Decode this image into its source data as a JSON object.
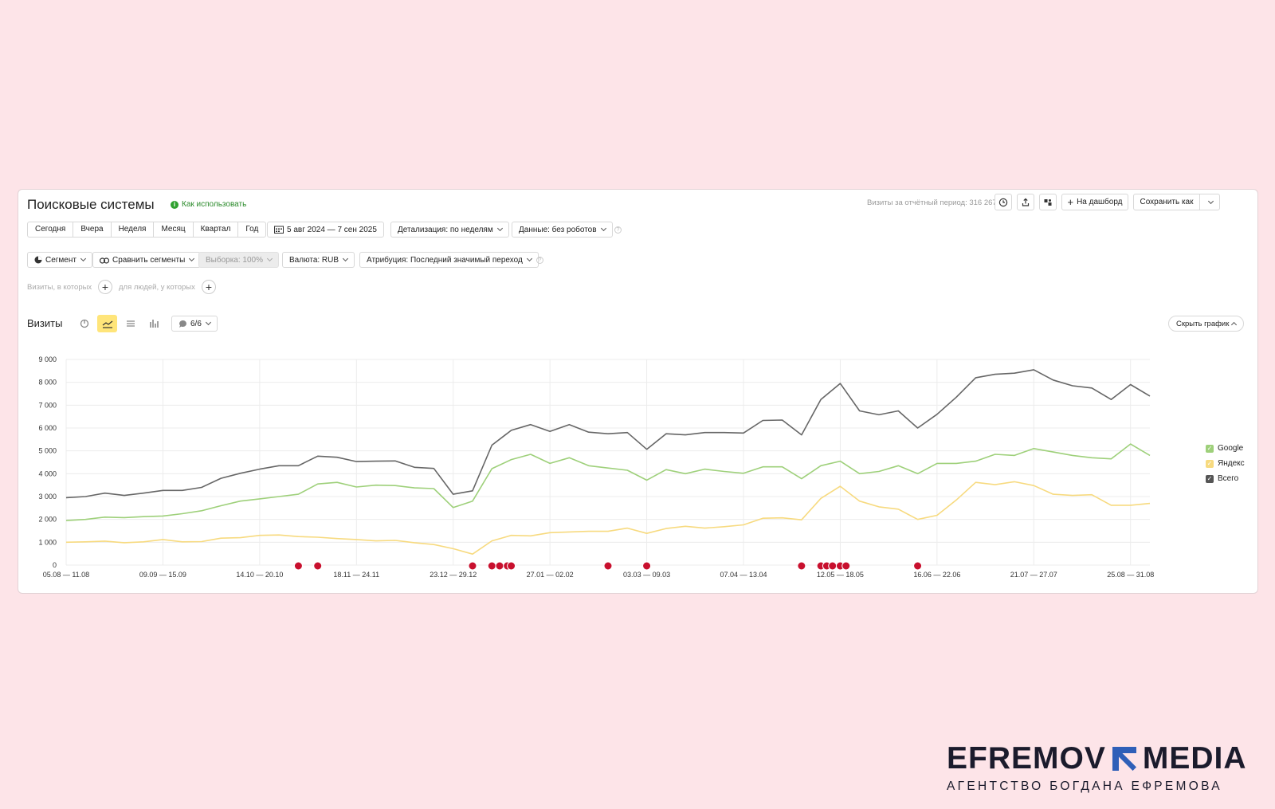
{
  "header": {
    "title": "Поисковые системы",
    "how_to_use": "Как использовать",
    "visits_total": "Визиты за отчётный период: 316 267",
    "to_dashboard": "На дашборд",
    "save_as": "Сохранить как"
  },
  "period_buttons": [
    "Сегодня",
    "Вчера",
    "Неделя",
    "Месяц",
    "Квартал",
    "Год"
  ],
  "date_range": "5 авг 2024 — 7 сен 2025",
  "detail": "Детализация: по неделям",
  "data_filter": "Данные: без роботов",
  "segment": "Сегмент",
  "compare": "Сравнить сегменты",
  "sample": "Выборка: 100%",
  "currency": "Валюта: RUB",
  "attribution": "Атрибуция: Последний значимый переход",
  "filters": {
    "visits_where": "Визиты, в которых",
    "people_where": "для людей, у которых"
  },
  "chart_header": {
    "label": "Визиты",
    "annotations": "6/6",
    "hide": "Скрыть график"
  },
  "colors": {
    "google": "#9ed07a",
    "yandex": "#f7da7f",
    "total": "#666666",
    "marker": "#c8102e",
    "accent": "#ffe57a"
  },
  "chart_data": {
    "type": "line",
    "x_ticks": [
      "05.08 — 11.08",
      "09.09 — 15.09",
      "14.10 — 20.10",
      "18.11 — 24.11",
      "23.12 — 29.12",
      "27.01 — 02.02",
      "03.03 — 09.03",
      "07.04 — 13.04",
      "12.05 — 18.05",
      "16.06 — 22.06",
      "21.07 — 27.07",
      "25.08 — 31.08"
    ],
    "y_ticks": [
      "0",
      "1 000",
      "2 000",
      "3 000",
      "4 000",
      "5 000",
      "6 000",
      "7 000",
      "8 000",
      "9 000"
    ],
    "ylim": [
      0,
      9000
    ],
    "series": [
      {
        "name": "Google",
        "values": [
          1950,
          2000,
          2100,
          2080,
          2120,
          2150,
          2250,
          2380,
          2600,
          2800,
          2900,
          3000,
          3100,
          3550,
          3620,
          3420,
          3500,
          3480,
          3380,
          3350,
          2520,
          2800,
          4220,
          4620,
          4850,
          4450,
          4700,
          4350,
          4250,
          4150,
          3720,
          4180,
          4000,
          4200,
          4100,
          4020,
          4300,
          4300,
          3780,
          4350,
          4550,
          4000,
          4100,
          4350,
          4000,
          4450,
          4450,
          4550,
          4850,
          4800,
          5100,
          4950,
          4800,
          4700,
          4650,
          5300,
          4800
        ]
      },
      {
        "name": "Яндекс",
        "values": [
          1000,
          1020,
          1050,
          980,
          1020,
          1120,
          1020,
          1030,
          1180,
          1200,
          1300,
          1320,
          1250,
          1220,
          1160,
          1120,
          1060,
          1080,
          980,
          900,
          720,
          480,
          1060,
          1300,
          1280,
          1420,
          1450,
          1480,
          1480,
          1620,
          1390,
          1600,
          1700,
          1620,
          1680,
          1760,
          2050,
          2070,
          1980,
          2920,
          3450,
          2800,
          2550,
          2450,
          2000,
          2180,
          2850,
          3620,
          3520,
          3650,
          3480,
          3100,
          3050,
          3080,
          2620,
          2620,
          2700
        ]
      },
      {
        "name": "Всего",
        "values": [
          2950,
          3000,
          3150,
          3050,
          3150,
          3270,
          3270,
          3400,
          3800,
          4020,
          4200,
          4350,
          4350,
          4770,
          4720,
          4530,
          4550,
          4560,
          4280,
          4230,
          3100,
          3250,
          5250,
          5900,
          6150,
          5850,
          6150,
          5820,
          5750,
          5800,
          5070,
          5750,
          5700,
          5800,
          5800,
          5780,
          6330,
          6350,
          5700,
          7250,
          7950,
          6750,
          6580,
          6750,
          6000,
          6600,
          7350,
          8200,
          8350,
          8400,
          8550,
          8100,
          7850,
          7750,
          7250,
          7900,
          7400
        ]
      }
    ],
    "markers": [
      12,
      13,
      21,
      22,
      22.4,
      22.8,
      23,
      28,
      30,
      38,
      39,
      39.3,
      39.6,
      40,
      40.3,
      44
    ]
  },
  "brand": {
    "name_left": "EFREMOV",
    "name_right": "MEDIA",
    "tagline": "АГЕНТСТВО БОГДАНА ЕФРЕМОВА"
  }
}
